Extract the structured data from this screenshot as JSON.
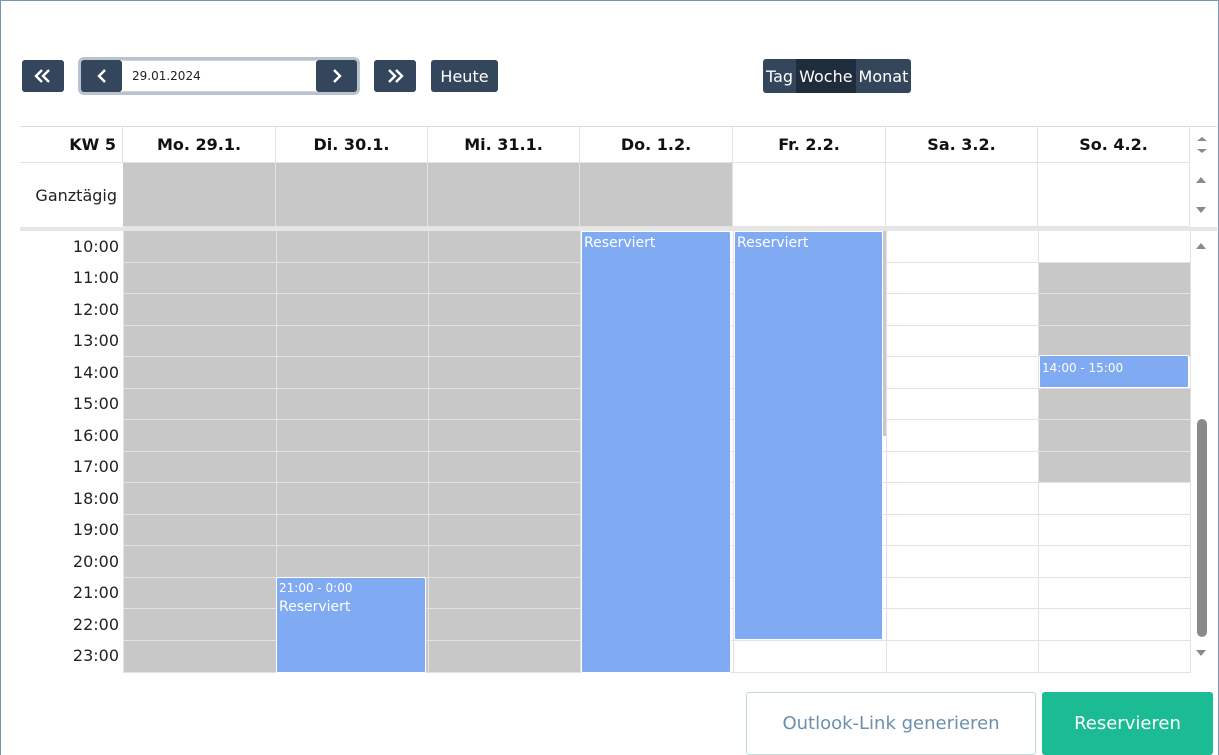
{
  "toolbar": {
    "date_value": "29.01.2024",
    "today_label": "Heute",
    "first_icon": "double-chevron-left-icon",
    "prev_icon": "chevron-left-icon",
    "next_icon": "chevron-right-icon",
    "last_icon": "double-chevron-right-icon",
    "views": [
      {
        "label": "Tag",
        "active": false
      },
      {
        "label": "Woche",
        "active": true
      },
      {
        "label": "Monat",
        "active": false
      }
    ]
  },
  "calendar": {
    "week_label": "KW 5",
    "days": [
      "Mo. 29.1.",
      "Di. 30.1.",
      "Mi. 31.1.",
      "Do. 1.2.",
      "Fr. 2.2.",
      "Sa. 3.2.",
      "So. 4.2."
    ],
    "allday_label": "Ganztägig",
    "hours": [
      "10:00",
      "11:00",
      "12:00",
      "13:00",
      "14:00",
      "15:00",
      "16:00",
      "17:00",
      "18:00",
      "19:00",
      "20:00",
      "21:00",
      "22:00",
      "23:00"
    ],
    "events": [
      {
        "day": "Di. 30.1.",
        "time": "21:00 - 0:00",
        "title": "Reserviert"
      },
      {
        "day": "Do. 1.2.",
        "time": "",
        "title": "Reserviert"
      },
      {
        "day": "Fr. 2.2.",
        "time": "",
        "title": "Reserviert"
      },
      {
        "day": "So. 4.2.",
        "time": "14:00 - 15:00",
        "title": ""
      }
    ]
  },
  "footer": {
    "outlook_label": "Outlook-Link generieren",
    "reserve_label": "Reservieren"
  },
  "colors": {
    "event": "#80abf2",
    "unavailable": "#c8c8c8",
    "primary": "#1bbc93",
    "toolbar": "#34465b"
  }
}
